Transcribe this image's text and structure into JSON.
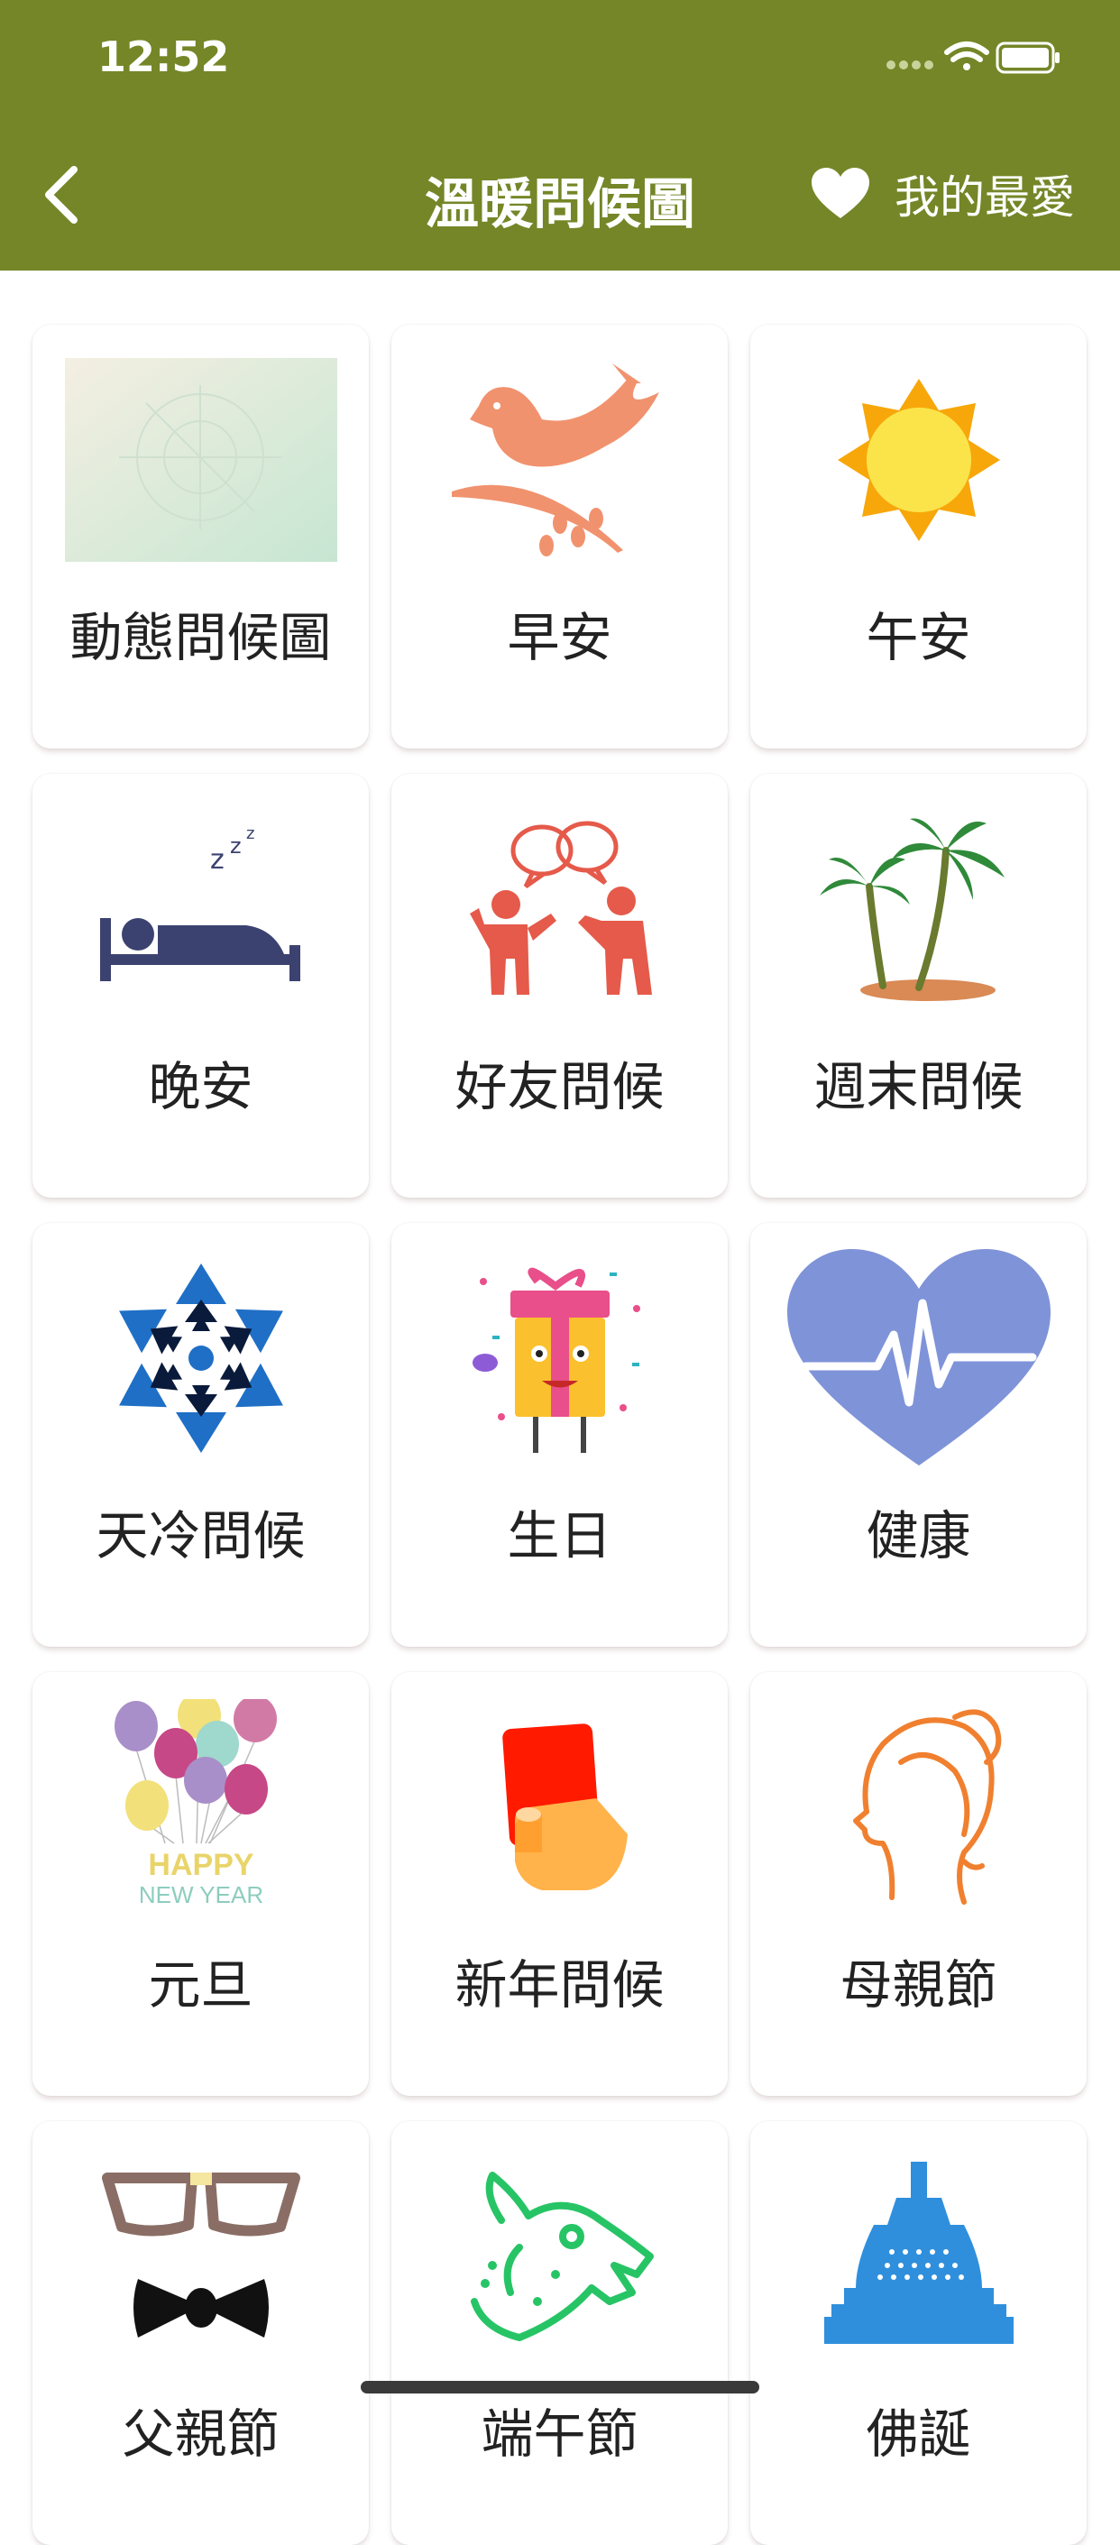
{
  "status": {
    "time": "12:52"
  },
  "header": {
    "title": "溫暖問候圖",
    "favorites_label": "我的最愛",
    "background_color": "#748627"
  },
  "categories": [
    {
      "label": "動態問候圖",
      "icon": "animated-greeting-thumbnail-icon"
    },
    {
      "label": "早安",
      "icon": "bird-icon"
    },
    {
      "label": "午安",
      "icon": "sun-icon"
    },
    {
      "label": "晚安",
      "icon": "sleeping-moon-icon"
    },
    {
      "label": "好友問候",
      "icon": "friends-chat-icon"
    },
    {
      "label": "週末問候",
      "icon": "palm-tree-icon"
    },
    {
      "label": "天冷問候",
      "icon": "snowflake-icon"
    },
    {
      "label": "生日",
      "icon": "gift-box-icon"
    },
    {
      "label": "健康",
      "icon": "heartbeat-icon"
    },
    {
      "label": "元旦",
      "icon": "balloons-icon",
      "icon_text": [
        "HAPPY",
        "NEW YEAR"
      ]
    },
    {
      "label": "新年問候",
      "icon": "red-envelope-hand-icon"
    },
    {
      "label": "母親節",
      "icon": "woman-profile-icon"
    },
    {
      "label": "父親節",
      "icon": "glasses-bowtie-icon"
    },
    {
      "label": "端午節",
      "icon": "dragon-icon"
    },
    {
      "label": "佛誕",
      "icon": "stupa-icon"
    }
  ]
}
